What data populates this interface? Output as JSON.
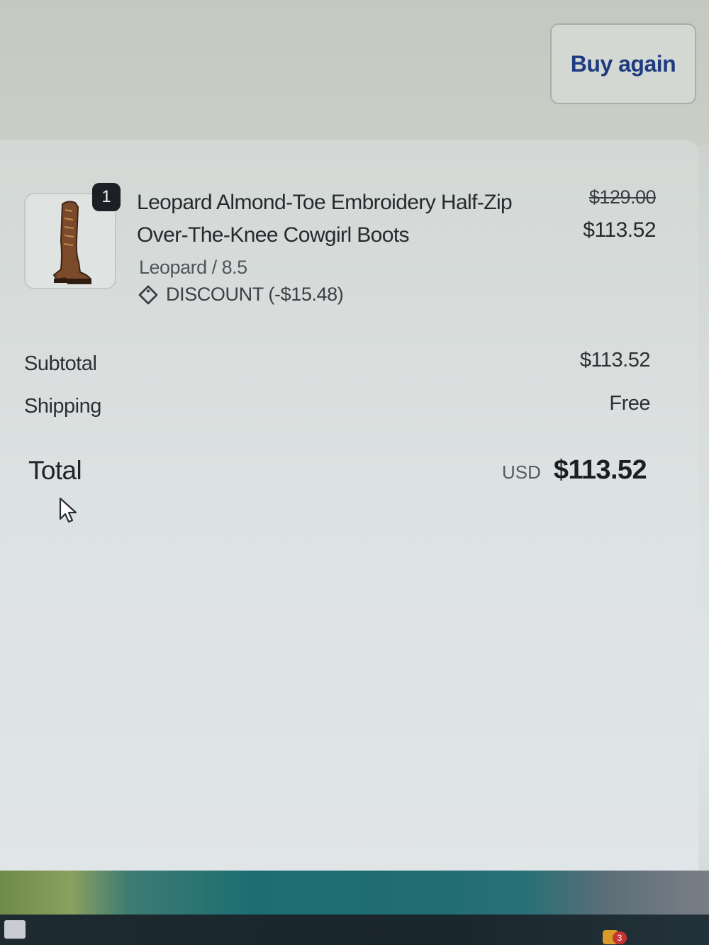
{
  "actions": {
    "buy_again_label": "Buy again"
  },
  "order_item": {
    "quantity": "1",
    "name": "Leopard Almond-Toe Embroidery Half-Zip Over-The-Knee Cowgirl Boots",
    "variant": "Leopard / 8.5",
    "discount_label": "DISCOUNT (-$15.48)",
    "original_price": "$129.00",
    "price": "$113.52",
    "image_icon": "cowgirl-boot"
  },
  "summary": {
    "subtotal_label": "Subtotal",
    "subtotal_value": "$113.52",
    "shipping_label": "Shipping",
    "shipping_value": "Free",
    "total_label": "Total",
    "currency": "USD",
    "total_value": "$113.52"
  },
  "taskbar": {
    "notification_count": "3"
  },
  "colors": {
    "button_text": "#1f3a80",
    "badge_bg": "#1d1f24"
  }
}
